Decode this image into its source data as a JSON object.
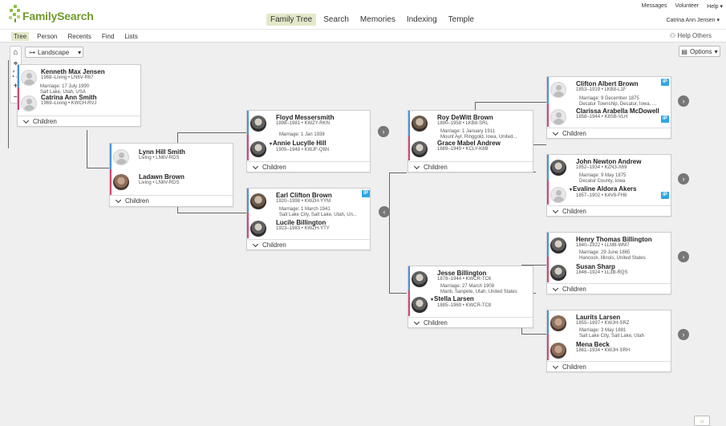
{
  "header": {
    "logo": "FamilySearch",
    "nav": [
      {
        "label": "Family Tree",
        "active": true
      },
      {
        "label": "Search",
        "active": false
      },
      {
        "label": "Memories",
        "active": false
      },
      {
        "label": "Indexing",
        "active": false
      },
      {
        "label": "Temple",
        "active": false
      }
    ],
    "utility": {
      "messages": "Messages",
      "volunteer": "Volunteer",
      "help": "Help ▾"
    },
    "user": "Catrina Ann Jensen ▾"
  },
  "subnav": {
    "items": [
      "Tree",
      "Person",
      "Recents",
      "Find",
      "Lists"
    ],
    "active": "Tree",
    "help_others": "Help Others"
  },
  "controls": {
    "view_mode": "Landscape",
    "options": "Options"
  },
  "children_label": "Children",
  "people": {
    "kenneth": {
      "name": "Kenneth Max Jensen",
      "meta": "1968–Living • LN6V-R67"
    },
    "catrina": {
      "name": "Catrina Ann Smith",
      "meta": "1969–Living • KWCH-RVJ"
    },
    "marr_kc": {
      "line1": "Marriage: 17 July 1990",
      "line2": "Salt Lake, Utah, USA"
    },
    "lynn": {
      "name": "Lynn Hill Smith",
      "meta": "Living • LN6V-RDS"
    },
    "ladawn": {
      "name": "Ladawn Brown",
      "meta": "Living • LN6V-RDS"
    },
    "floyd": {
      "name": "Floyd Messersmith",
      "meta": "1898–1981 • KWZY-RKN"
    },
    "annie": {
      "name": "Annie Lucylle Hill",
      "meta": "1905–1948 • KWJF-Q6N"
    },
    "marr_fa": {
      "line1": "Marriage: 1 Jan 1938"
    },
    "earl": {
      "name": "Earl Clifton Brown",
      "meta": "1920–1998 • KWZH-YYM"
    },
    "lucile": {
      "name": "Lucile Billington",
      "meta": "1923–1983 • KWZH-YTY"
    },
    "marr_el": {
      "line1": "Marriage: 1 March 1941",
      "line2": "Salt Lake City, Salt Lake, Utah, Un..."
    },
    "roy": {
      "name": "Roy DeWitt Brown",
      "meta": "1890–1958 • LKB8-SRL"
    },
    "grace": {
      "name": "Grace Mabel Andrew",
      "meta": "1889–1949 • KCLY-K8B"
    },
    "marr_rg": {
      "line1": "Marriage: 1 January 1911",
      "line2": "Mount Ayr, Ringgold, Iowa, United..."
    },
    "jesse": {
      "name": "Jesse Billington",
      "meta": "1878–1944 • KWCR-TC6"
    },
    "stella": {
      "name": "Stella Larsen",
      "meta": "1885–1969 • KWCR-TC8"
    },
    "marr_js": {
      "line1": "Marriage: 27 March 1908",
      "line2": "Manti, Sanpete, Utah, United States"
    },
    "clifton": {
      "name": "Clifton Albert Brown",
      "meta": "1853–1919 • LKB8-L1F"
    },
    "clarissa": {
      "name": "Clarissa Arabella McDowell",
      "meta": "1858–1944 • K8SB-VLH"
    },
    "marr_cc": {
      "line1": "Marriage: 9 December 1875",
      "line2": "Decatur Township, Decatur, Iowa, ..."
    },
    "john": {
      "name": "John Newton Andrew",
      "meta": "1852–1934 • KZN3-X69"
    },
    "evaline": {
      "name": "Evaline Aldora Akers",
      "meta": "1857–1902 • K4V8-FH6"
    },
    "marr_je": {
      "line1": "Marriage: 9 May 1875",
      "line2": "Decatur County, Iowa"
    },
    "henry": {
      "name": "Henry Thomas Billington",
      "meta": "1840–1922 • LLM8-WM7"
    },
    "susan": {
      "name": "Susan Sharp",
      "meta": "1846–1924 • LL3B-RQS"
    },
    "marr_hs": {
      "line1": "Marriage: 29 June 1865",
      "line2": "Hancock, Illinois, United States"
    },
    "laurits": {
      "name": "Laurits Larsen",
      "meta": "1855–1897 • KWJH-SRZ"
    },
    "mena": {
      "name": "Mena Beck",
      "meta": "1861–1934 • KWJH-SRH"
    },
    "marr_lm": {
      "line1": "Marriage: 3 May 1881",
      "line2": "Salt Lake City, Salt Lake, Utah"
    }
  },
  "badge_label": "IP"
}
